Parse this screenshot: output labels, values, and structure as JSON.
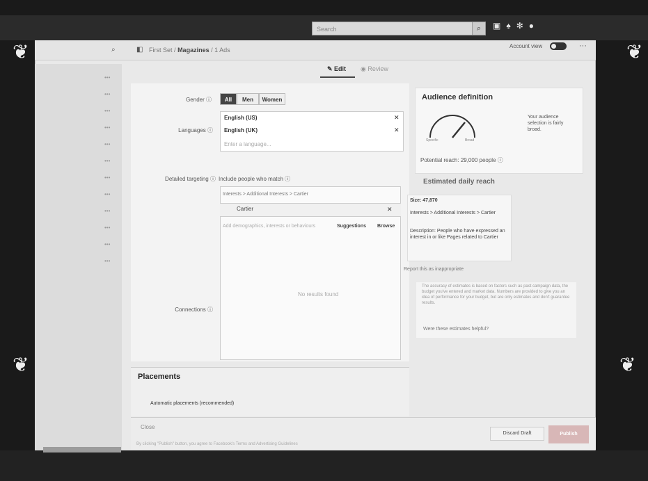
{
  "topbar": {
    "search_placeholder": "Search",
    "search_icon": "search-icon",
    "icons": [
      "avatar-icon",
      "notification-bell-icon",
      "gear-icon",
      "help-icon"
    ]
  },
  "header": {
    "crumb_first": "First Set",
    "crumb_sep1": "/",
    "crumb_active": "Magazines",
    "crumb_sep2": "/",
    "crumb_last": "1 Ads",
    "account_label": "Account view"
  },
  "tabs": {
    "edit": "Edit",
    "review": "Review"
  },
  "form": {
    "gender_label": "Gender",
    "gender_options": [
      "All",
      "Men",
      "Women"
    ],
    "languages_label": "Languages",
    "languages": [
      "English (US)",
      "English (UK)"
    ],
    "language_placeholder": "Enter a language...",
    "detailed_targeting_label": "Detailed targeting",
    "include_text": "Include people who match",
    "interest_path": "Interests > Additional Interests > Cartier",
    "interest_chip": "Cartier",
    "dt_placeholder": "Add demographics, interests or behaviours",
    "suggestions": "Suggestions",
    "browse": "Browse",
    "no_results": "No results found",
    "connections_label": "Connections"
  },
  "audience": {
    "title": "Audience definition",
    "gauge_left": "Specific",
    "gauge_right": "Broad",
    "description": "Your audience selection is fairly broad.",
    "reach": "Potential reach: 29,000 people",
    "estimated_title": "Estimated daily reach"
  },
  "info_panel": {
    "size": "Size: 47,870",
    "interests": "Interests > Additional Interests > Cartier",
    "description": "Description: People who have expressed an interest in or like Pages related to Cartier",
    "report": "Report this as inappropriate",
    "disclaimer": "The accuracy of estimates is based on factors such as past campaign data, the budget you've entered and market data. Numbers are provided to give you an idea of performance for your budget, but are only estimates and don't guarantee results.",
    "helpful": "Were these estimates helpful?"
  },
  "placements": {
    "title": "Placements",
    "option": "Automatic placements (recommended)"
  },
  "footer": {
    "close": "Close",
    "terms": "By clicking \"Publish\" button, you agree to Facebook's Terms and Advertising Guidelines",
    "discard": "Discard Draft",
    "publish": "Publish"
  }
}
